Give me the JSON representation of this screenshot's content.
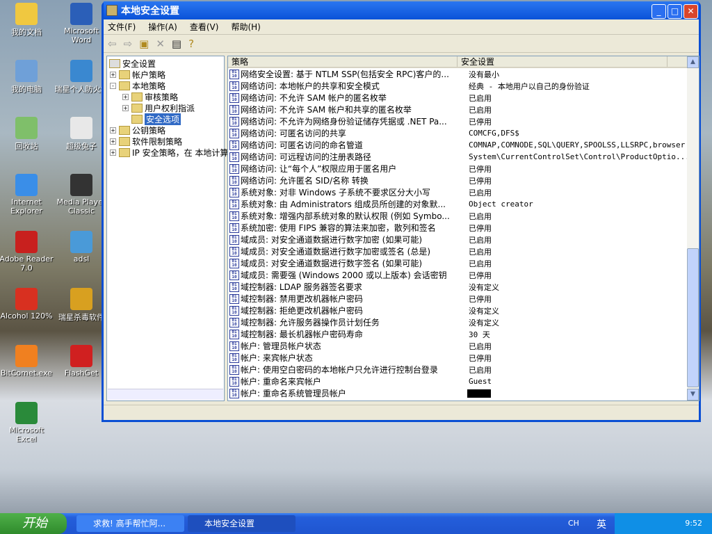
{
  "desktop_icons": [
    {
      "label": "我的文档",
      "color": "#f0c840"
    },
    {
      "label": "Microsoft Word",
      "color": "#2b5fb8"
    },
    {
      "label": "我的电脑",
      "color": "#6fa0d8"
    },
    {
      "label": "瑞星个人防火墙",
      "color": "#3a88d0"
    },
    {
      "label": "回收站",
      "color": "#7fbf6a"
    },
    {
      "label": "超级兔子",
      "color": "#e8e8e8"
    },
    {
      "label": "Internet Explorer",
      "color": "#3a8ee8"
    },
    {
      "label": "Media Player Classic",
      "color": "#333333"
    },
    {
      "label": "Adobe Reader 7.0",
      "color": "#c8201e"
    },
    {
      "label": "adsl",
      "color": "#4a9ad8"
    },
    {
      "label": "Alcohol 120%",
      "color": "#d83020"
    },
    {
      "label": "瑞星杀毒软件",
      "color": "#d8a020"
    },
    {
      "label": "BitComet.exe",
      "color": "#f08020"
    },
    {
      "label": "FlashGet",
      "color": "#d02020"
    },
    {
      "label": "Microsoft Excel",
      "color": "#2a8a3a"
    }
  ],
  "window": {
    "title": "本地安全设置"
  },
  "menu": [
    "文件(F)",
    "操作(A)",
    "查看(V)",
    "帮助(H)"
  ],
  "tree": {
    "root": "安全设置",
    "items": [
      {
        "label": "帐户策略",
        "exp": "+",
        "level": 1
      },
      {
        "label": "本地策略",
        "exp": "-",
        "level": 1
      },
      {
        "label": "审核策略",
        "exp": "+",
        "level": 2
      },
      {
        "label": "用户权利指派",
        "exp": "+",
        "level": 2
      },
      {
        "label": "安全选项",
        "exp": "",
        "level": 2,
        "selected": true
      },
      {
        "label": "公钥策略",
        "exp": "+",
        "level": 1
      },
      {
        "label": "软件限制策略",
        "exp": "+",
        "level": 1
      },
      {
        "label": "IP 安全策略，在 本地计算机",
        "exp": "+",
        "level": 1
      }
    ]
  },
  "list": {
    "columns": [
      "策略",
      "安全设置"
    ],
    "rows": [
      [
        "网络安全设置: 基于 NTLM SSP(包括安全 RPC)客户的...",
        "没有最小"
      ],
      [
        "网络访问: 本地帐户的共享和安全模式",
        "经典 - 本地用户以自己的身份验证"
      ],
      [
        "网络访问: 不允许 SAM 帐户的匿名枚举",
        "已启用"
      ],
      [
        "网络访问: 不允许 SAM 帐户和共享的匿名枚举",
        "已启用"
      ],
      [
        "网络访问: 不允许为网络身份验证储存凭据或 .NET Pa...",
        "已停用"
      ],
      [
        "网络访问: 可匿名访问的共享",
        "COMCFG,DFS$"
      ],
      [
        "网络访问: 可匿名访问的命名管道",
        "COMNAP,COMNODE,SQL\\QUERY,SPOOLSS,LLSRPC,browser"
      ],
      [
        "网络访问: 可远程访问的注册表路径",
        "System\\CurrentControlSet\\Control\\ProductOptio..."
      ],
      [
        "网络访问: 让“每个人”权限应用于匿名用户",
        "已停用"
      ],
      [
        "网络访问: 允许匿名 SID/名称 转换",
        "已停用"
      ],
      [
        "系统对象: 对非 Windows 子系统不要求区分大小写",
        "已启用"
      ],
      [
        "系统对象: 由 Administrators 组成员所创建的对象默...",
        "Object creator"
      ],
      [
        "系统对象: 增强内部系统对象的默认权限 (例如 Symbo...",
        "已启用"
      ],
      [
        "系统加密: 使用 FIPS 兼容的算法来加密，散列和签名",
        "已停用"
      ],
      [
        "域成员: 对安全通道数据进行数字加密 (如果可能)",
        "已启用"
      ],
      [
        "域成员: 对安全通道数据进行数字加密或签名 (总是)",
        "已启用"
      ],
      [
        "域成员: 对安全通道数据进行数字签名 (如果可能)",
        "已启用"
      ],
      [
        "域成员: 需要强 (Windows 2000 或以上版本) 会话密钥",
        "已停用"
      ],
      [
        "域控制器: LDAP 服务器签名要求",
        "没有定义"
      ],
      [
        "域控制器: 禁用更改机器帐户密码",
        "已停用"
      ],
      [
        "域控制器: 拒绝更改机器帐户密码",
        "没有定义"
      ],
      [
        "域控制器: 允许服务器操作员计划任务",
        "没有定义"
      ],
      [
        "域控制器: 最长机器帐户密码寿命",
        "30 天"
      ],
      [
        "帐户: 管理员帐户状态",
        "已启用"
      ],
      [
        "帐户: 来宾帐户状态",
        "已停用"
      ],
      [
        "帐户: 使用空白密码的本地帐户只允许进行控制台登录",
        "已启用"
      ],
      [
        "帐户: 重命名来宾帐户",
        "Guest"
      ],
      [
        "帐户: 重命名系统管理员帐户",
        ""
      ]
    ]
  },
  "taskbar": {
    "start": "开始",
    "tasks": [
      "求救! 高手帮忙阿...",
      "本地安全设置"
    ],
    "lang": "CH",
    "ime": "英",
    "clock": "9:52"
  }
}
